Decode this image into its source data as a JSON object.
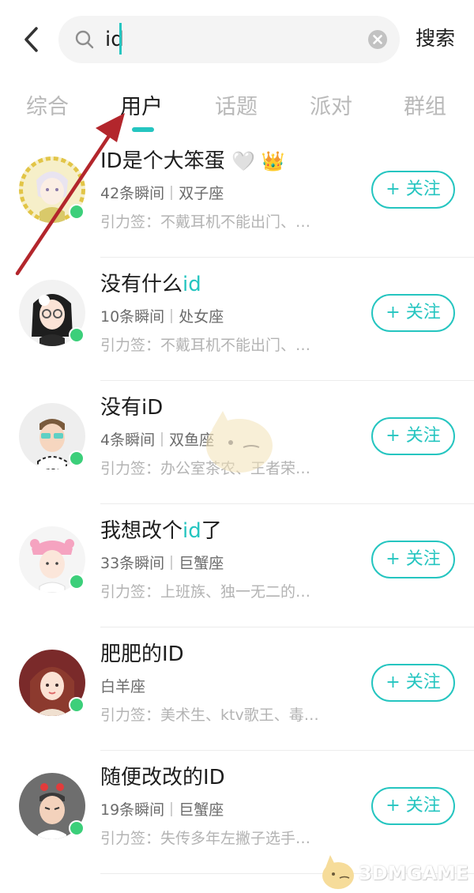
{
  "search": {
    "query": "id",
    "submit_label": "搜索"
  },
  "tabs": [
    {
      "label": "综合",
      "active": false
    },
    {
      "label": "用户",
      "active": true
    },
    {
      "label": "话题",
      "active": false
    },
    {
      "label": "派对",
      "active": false
    },
    {
      "label": "群组",
      "active": false
    }
  ],
  "users": [
    {
      "name_parts": [
        "ID是个大笨蛋",
        "",
        ""
      ],
      "name_emoji": "🤍 👑",
      "moments": "42条瞬间",
      "zodiac": "双子座",
      "tagline": "引力签：不戴耳机不能出门、…",
      "follow": "+ 关注"
    },
    {
      "name_parts": [
        "没有什么",
        "id",
        ""
      ],
      "moments": "10条瞬间",
      "zodiac": "处女座",
      "tagline": "引力签：不戴耳机不能出门、…",
      "follow": "+ 关注"
    },
    {
      "name_parts": [
        "没有iD",
        "",
        ""
      ],
      "moments": "4条瞬间",
      "zodiac": "双鱼座",
      "tagline": "引力签：办公室茶农、王者荣…",
      "follow": "+ 关注"
    },
    {
      "name_parts": [
        "我想改个",
        "id",
        "了"
      ],
      "moments": "33条瞬间",
      "zodiac": "巨蟹座",
      "tagline": "引力签：上班族、独一无二的…",
      "follow": "+ 关注"
    },
    {
      "name_parts": [
        "肥肥的ID",
        "",
        ""
      ],
      "moments": "",
      "zodiac": "白羊座",
      "tagline": "引力签：美术生、ktv歌王、毒…",
      "follow": "+ 关注"
    },
    {
      "name_parts": [
        "随便改改的ID",
        "",
        ""
      ],
      "moments": "19条瞬间",
      "zodiac": "巨蟹座",
      "tagline": "引力签：失传多年左撇子选手…",
      "follow": "+ 关注"
    }
  ],
  "watermark": "3DMGAME",
  "colors": {
    "accent": "#25c5c0",
    "online": "#3ccf7a",
    "annotation_arrow": "#b3262c"
  }
}
